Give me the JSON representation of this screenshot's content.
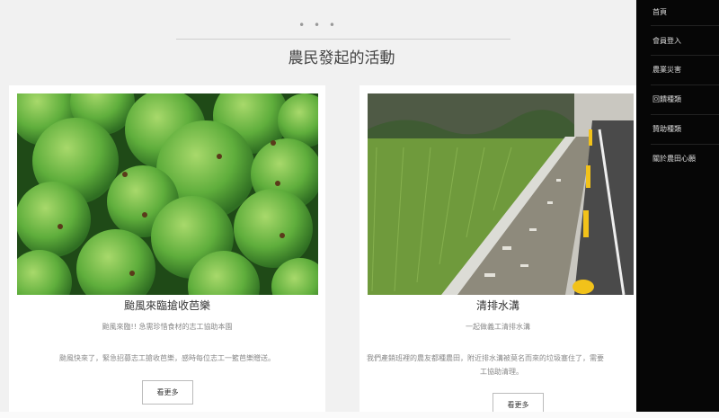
{
  "header": {
    "dots": "• • •",
    "title": "農民發起的活動"
  },
  "cards": [
    {
      "title": "颱風來臨搶收芭樂",
      "subtitle": "颱風來臨!! 急需珍惜食材的志工協助本園",
      "body": "颱風快來了，緊急招募志工搶收芭樂，感時每位志工一籃芭樂贈送。",
      "button": "看更多",
      "photo": "guava-photo"
    },
    {
      "title": "清排水溝",
      "subtitle": "一起做義工清排水溝",
      "body_line1": "我們產銷班裡的農友都種農田，附近排水溝被莫名而來的垃圾塞住了，需要",
      "body_line2": "工協助清理。",
      "button": "看更多",
      "photo": "drainage-ditch-photo"
    }
  ],
  "nav": {
    "items": [
      "首頁",
      "會員登入",
      "農業災害",
      "回饋種類",
      "贊助種類",
      "關於農田心願"
    ]
  },
  "colors": {
    "background": "#f1f1f1",
    "nav_bg": "#060606",
    "card_bg": "#ffffff"
  }
}
